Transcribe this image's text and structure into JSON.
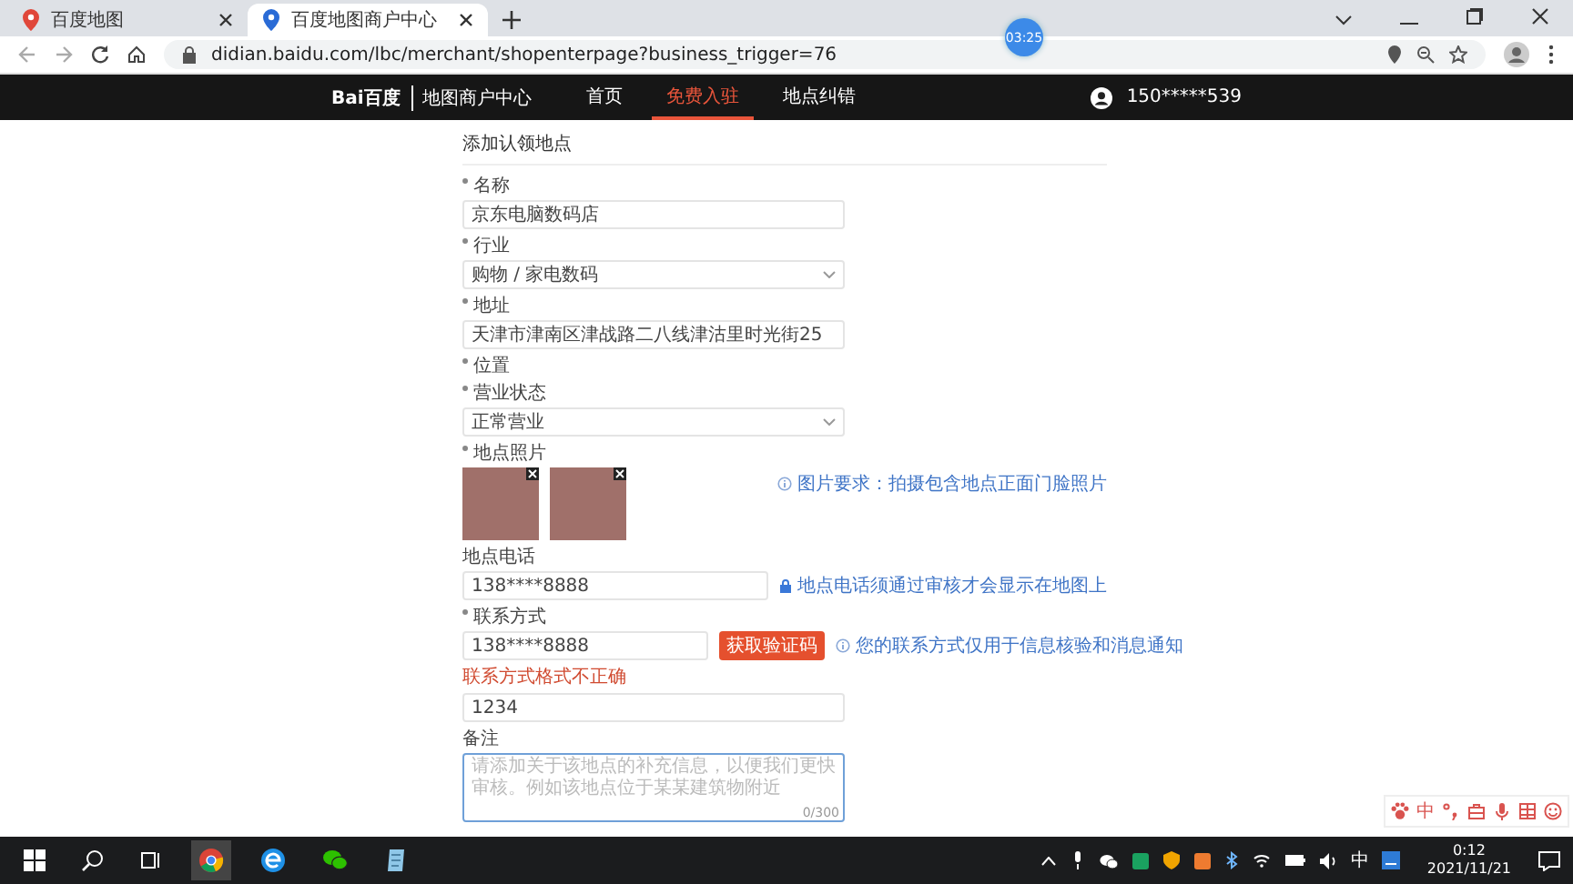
{
  "browser": {
    "tabs": [
      {
        "title": "百度地图",
        "selected": false
      },
      {
        "title": "百度地图商户中心",
        "selected": true
      }
    ],
    "url": "didian.baidu.com/lbc/merchant/shopenterpage?business_trigger=76",
    "timer": "03:25"
  },
  "site_nav": {
    "logo": "Bai百度",
    "product": "地图商户中心",
    "items": [
      {
        "label": "首页",
        "selected": false
      },
      {
        "label": "免费入驻",
        "selected": true
      },
      {
        "label": "地点纠错",
        "selected": false
      }
    ],
    "user": "150*****539"
  },
  "form": {
    "title": "添加认领地点",
    "fields": [
      {
        "kind": "input",
        "label": "名称",
        "required": true,
        "value": "京东电脑数码店"
      },
      {
        "kind": "select",
        "label": "行业",
        "required": true,
        "value": "购物 / 家电数码"
      },
      {
        "kind": "input",
        "label": "地址",
        "required": true,
        "value": "天津市津南区津战路二八线津沽里时光街25"
      },
      {
        "kind": "static",
        "label": "位置",
        "required": true
      },
      {
        "kind": "select",
        "label": "营业状态",
        "required": true,
        "value": "正常营业"
      },
      {
        "kind": "photos",
        "label": "地点照片",
        "required": true,
        "photos": [
          {
            "removable": true
          },
          {
            "removable": true
          }
        ],
        "hint": "图片要求：拍摄包含地点正面门脸照片",
        "hint_locked": false
      },
      {
        "kind": "input",
        "label": "地点电话",
        "required": false,
        "value": "138****8888",
        "hint": "地点电话须通过审核才会显示在地图上",
        "hint_locked": true
      },
      {
        "kind": "verify",
        "label": "联系方式",
        "required": true,
        "value": "138****8888",
        "button": "获取验证码",
        "hint": "您的联系方式仅用于信息核验和消息通知",
        "hint_locked": false,
        "error": "联系方式格式不正确",
        "code": "1234"
      },
      {
        "kind": "textarea",
        "label": "备注",
        "required": false,
        "placeholder": "请添加关于该地点的补充信息，以便我们更快审核。例如该地点位于某某建筑物附近",
        "counter": "0/300"
      }
    ]
  },
  "ime_bar": {
    "mode": "中"
  },
  "taskbar": {
    "ime": "中",
    "time": "0:12",
    "date": "2021/11/21"
  }
}
